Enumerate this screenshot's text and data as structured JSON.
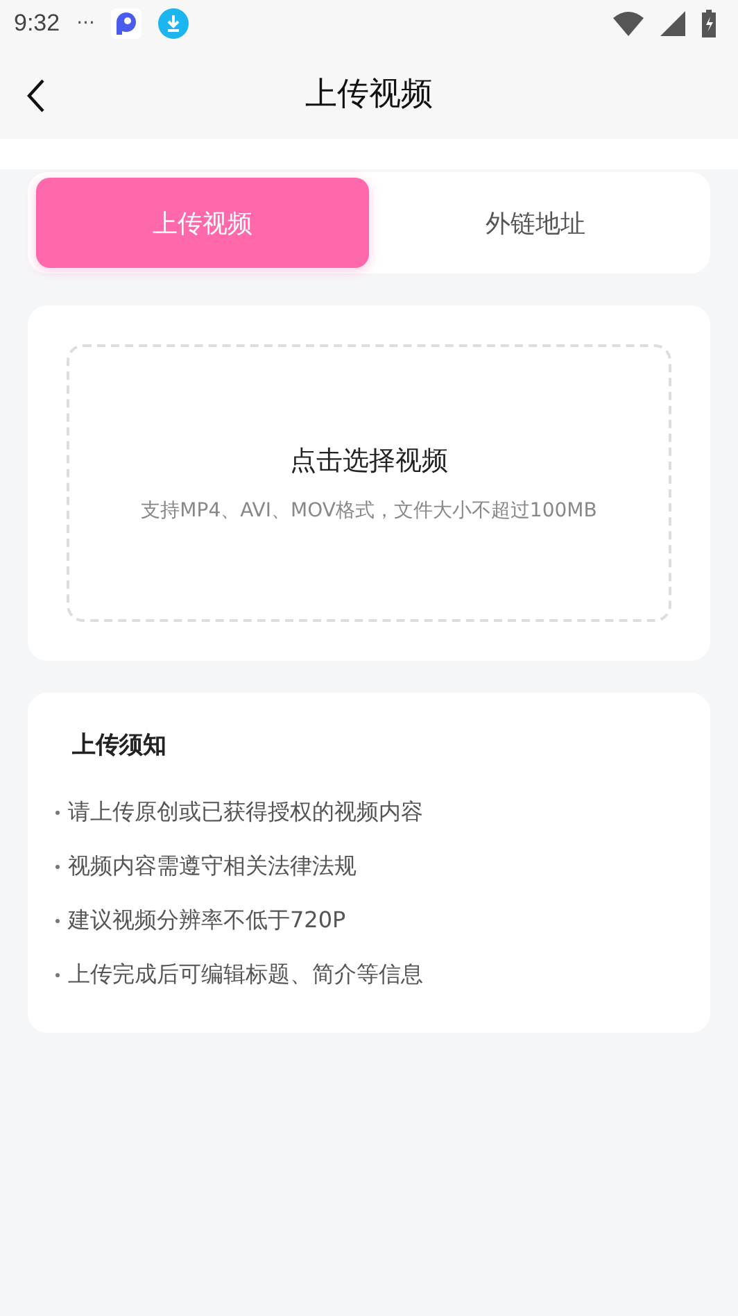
{
  "status_bar": {
    "time": "9:32",
    "more": "···"
  },
  "header": {
    "title": "上传视频"
  },
  "tabs": [
    {
      "label": "上传视频",
      "selected": true
    },
    {
      "label": "外链地址",
      "selected": false
    }
  ],
  "upload": {
    "title": "点击选择视频",
    "hint": "支持MP4、AVI、MOV格式，文件大小不超过100MB"
  },
  "notes": {
    "title": "上传须知",
    "items": [
      "请上传原创或已获得授权的视频内容",
      "视频内容需遵守相关法律法规",
      "建议视频分辨率不低于720P",
      "上传完成后可编辑标题、简介等信息"
    ]
  }
}
